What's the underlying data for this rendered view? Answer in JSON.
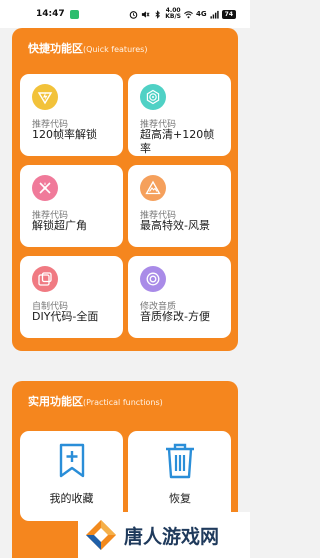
{
  "status_bar": {
    "time": "14:47",
    "net_speed_value": "4.00",
    "net_speed_unit": "KB/S",
    "network_type": "4G",
    "battery": "74"
  },
  "quick": {
    "title": "快捷功能区",
    "subtitle": "(Quick features)",
    "cards": [
      {
        "tag": "推荐代码",
        "title": "120帧率解锁",
        "icon": "lightning-icon",
        "color": "#f2c23a"
      },
      {
        "tag": "推荐代码",
        "title": "超高清+120帧率",
        "icon": "target-icon",
        "color": "#4fd1c5"
      },
      {
        "tag": "推荐代码",
        "title": "解锁超广角",
        "icon": "cross-sparkle-icon",
        "color": "#f07a9a"
      },
      {
        "tag": "推荐代码",
        "title": "最高特效-风景",
        "icon": "mountain-icon",
        "color": "#f5a05c"
      },
      {
        "tag": "自制代码",
        "title": "DIY代码-全面",
        "icon": "frame-icon",
        "color": "#f07a82"
      },
      {
        "tag": "修改音质",
        "title": "音质修改-方便",
        "icon": "audio-ring-icon",
        "color": "#a98be8"
      }
    ]
  },
  "practical": {
    "title": "实用功能区",
    "subtitle": "(Practical functions)",
    "cards": [
      {
        "label": "我的收藏",
        "icon": "bookmark-plus-icon",
        "color": "#2a8ed8"
      },
      {
        "label": "恢复",
        "icon": "trash-icon",
        "color": "#2a8ed8"
      }
    ]
  },
  "watermark": {
    "text": "唐人游戏网"
  }
}
